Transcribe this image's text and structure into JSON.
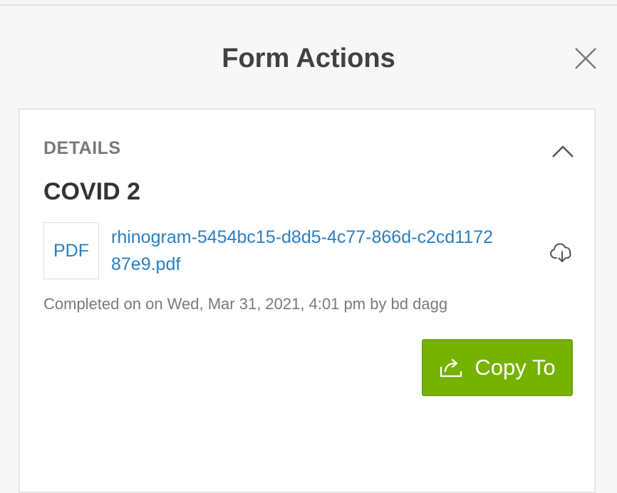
{
  "modal": {
    "title": "Form Actions",
    "close_icon": "close-icon"
  },
  "details": {
    "section_label": "DETAILS",
    "collapse_icon": "chevron-up-icon",
    "form_name": "COVID 2",
    "file_type": "PDF",
    "file_name": "rhinogram-5454bc15-d8d5-4c77-866d-c2cd117287e9.pdf",
    "download_icon": "cloud-download-icon",
    "completed_text": "Completed on on Wed, Mar 31, 2021, 4:01 pm by bd dagg",
    "copy_button": {
      "label": "Copy To",
      "icon": "share-icon"
    }
  },
  "colors": {
    "accent_green": "#76b300",
    "link_blue": "#2a7ec3",
    "title_text": "#414141"
  }
}
